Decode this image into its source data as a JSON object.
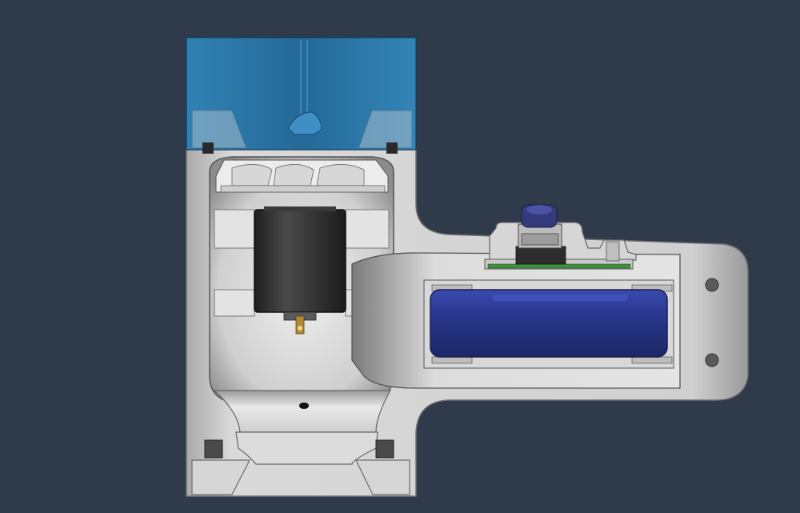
{
  "scene": {
    "background": "#2f3a4a",
    "body_color": "#c9c9c9",
    "cavity_color": "#e8e8e8",
    "reservoir_color": "#1e6a9a",
    "battery_color": "#2b3a8f",
    "motor_color": "#2a2a2a",
    "pcb_color": "#3f8f3f",
    "connector_color": "#343a7a"
  },
  "parts": {
    "reservoir": "water-reservoir",
    "pump_motor": "dc-motor",
    "impeller": "impeller",
    "battery": "cylindrical-battery",
    "pcb": "circuit-board",
    "button": "push-button",
    "outlet": "outlet-hole",
    "mount_holes": "mounting-holes"
  }
}
